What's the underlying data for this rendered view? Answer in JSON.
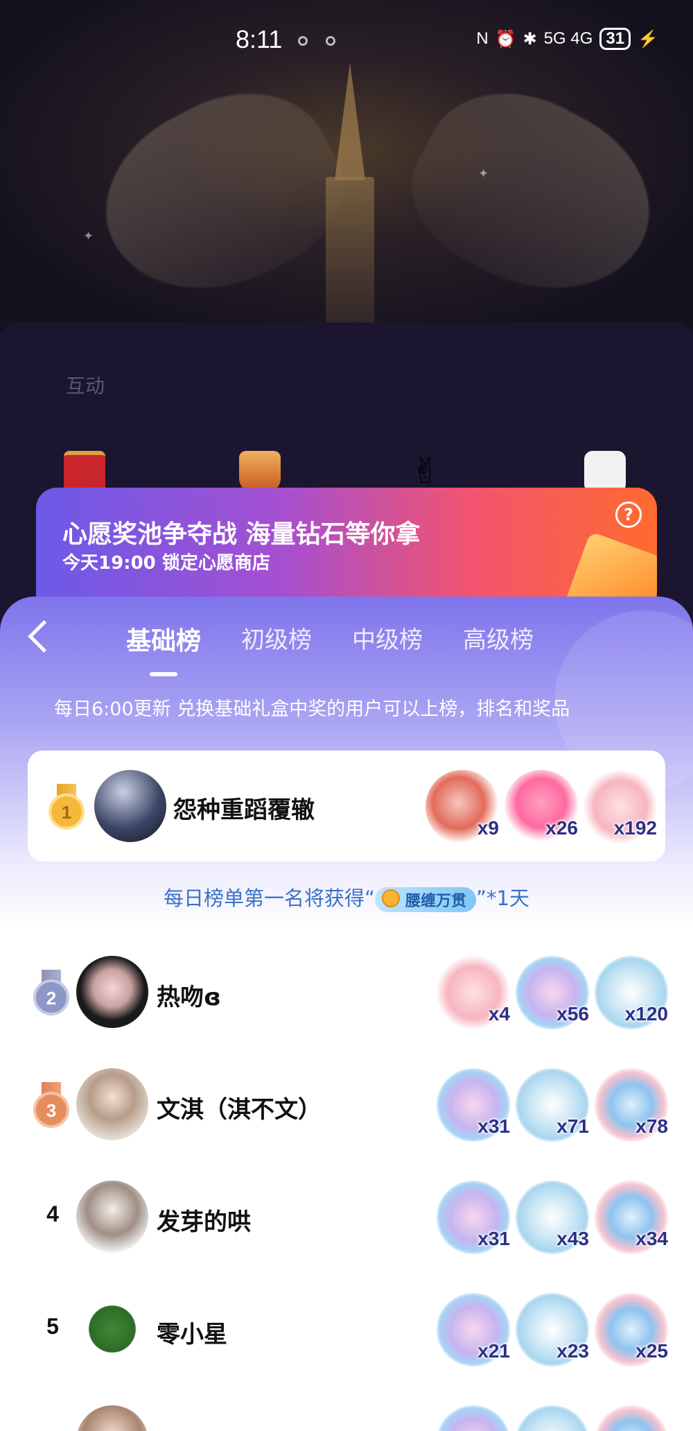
{
  "status_bar": {
    "time": "8:11",
    "network": "5G 4G",
    "battery": "31"
  },
  "panel": {
    "section_label": "互动"
  },
  "banner": {
    "title": "心愿奖池争夺战 海量钻石等你拿",
    "subtitle": "今天19:00 锁定心愿商店",
    "help": "?"
  },
  "tabs": [
    "基础榜",
    "初级榜",
    "中级榜",
    "高级榜"
  ],
  "notice": "每日6:00更新 兑换基础礼盒中奖的用户可以上榜，排名和奖品",
  "first": {
    "rank": "1",
    "name": "怨种重蹈覆辙",
    "gifts": [
      {
        "icon": "lion-dance-gift",
        "count": "x9"
      },
      {
        "icon": "heart-key-gift",
        "count": "x26"
      },
      {
        "icon": "cake-box-gift",
        "count": "x192"
      }
    ]
  },
  "reward": {
    "prefix": "每日榜单第一名将获得“",
    "badge": "腰缠万贯",
    "suffix": "”*1天"
  },
  "list": [
    {
      "rank": "2",
      "name": "热吻ɞ",
      "gifts": [
        {
          "icon": "cake-box-gift",
          "count": "x4"
        },
        {
          "icon": "mermaid-gift",
          "count": "x56"
        },
        {
          "icon": "pearl-shell-gift",
          "count": "x120"
        }
      ]
    },
    {
      "rank": "3",
      "name": "文淇（淇不文）",
      "gifts": [
        {
          "icon": "mermaid-gift",
          "count": "x31"
        },
        {
          "icon": "pearl-shell-gift",
          "count": "x71"
        },
        {
          "icon": "seahorse-gift",
          "count": "x78"
        }
      ]
    },
    {
      "rank": "4",
      "name": "发芽的哄",
      "gifts": [
        {
          "icon": "mermaid-gift",
          "count": "x31"
        },
        {
          "icon": "pearl-shell-gift",
          "count": "x43"
        },
        {
          "icon": "seahorse-gift",
          "count": "x34"
        }
      ]
    },
    {
      "rank": "5",
      "name": "零小星",
      "gifts": [
        {
          "icon": "mermaid-gift",
          "count": "x21"
        },
        {
          "icon": "pearl-shell-gift",
          "count": "x23"
        },
        {
          "icon": "seahorse-gift",
          "count": "x25"
        }
      ]
    }
  ]
}
